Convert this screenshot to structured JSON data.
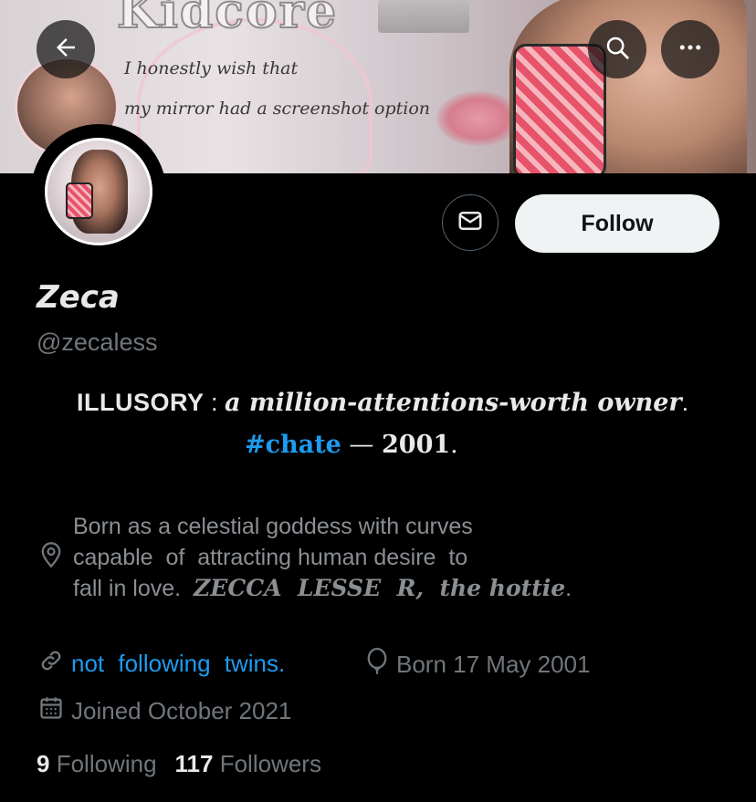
{
  "banner": {
    "brand_text": "Kidcore",
    "quote_line1": "I honestly wish that",
    "quote_line2": "my mirror had a screenshot option"
  },
  "toolbar": {
    "back_icon": "arrow-left-icon",
    "search_icon": "search-icon",
    "more_icon": "more-horizontal-icon"
  },
  "actions": {
    "message_icon": "mail-icon",
    "follow_label": "Follow"
  },
  "profile": {
    "display_name": "Zeca",
    "handle": "@zecaless"
  },
  "headline": {
    "label": "ILLUSORY",
    "separator": " : ",
    "phrase": "a million-attentions-worth owner",
    "end": ".",
    "hashtag": "#chate",
    "dash": " — ",
    "year": "2001",
    "year_end": "."
  },
  "bio": {
    "line1": "Born as a celestial goddess with curves",
    "line2": "capable  of  attracting human desire  to",
    "line3_plain": "fall in love.  ",
    "line3_em": "ZECCA  LESSE  R,  the hottie",
    "line3_end": "."
  },
  "meta": {
    "link_text": "not following twins.",
    "born": "Born 17 May 2001",
    "joined": "Joined October 2021"
  },
  "stats": {
    "following_count": "9",
    "following_label": "Following",
    "followers_count": "117",
    "followers_label": "Followers"
  },
  "colors": {
    "accent": "#1d9bf0",
    "muted": "#71767b",
    "text": "#e7e9ea",
    "background": "#000000"
  }
}
